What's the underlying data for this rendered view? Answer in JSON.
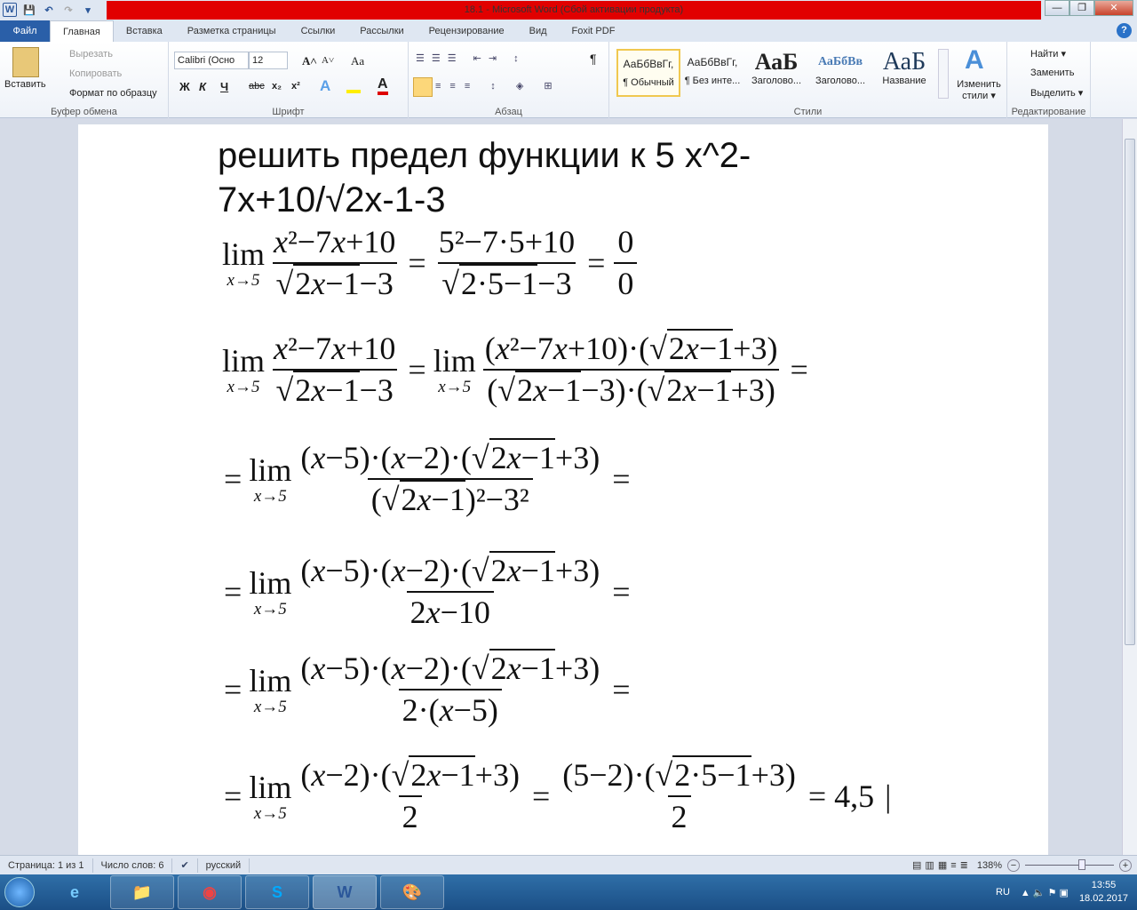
{
  "window": {
    "title": "18.1  -  Microsoft Word (Сбой активации продукта)",
    "minimize": "—",
    "maximize": "❐",
    "close": "✕"
  },
  "qat": {
    "word": "W",
    "save": "💾",
    "undo": "↶",
    "redo": "↷",
    "customize": "▾"
  },
  "tabs": [
    "Файл",
    "Главная",
    "Вставка",
    "Разметка страницы",
    "Ссылки",
    "Рассылки",
    "Рецензирование",
    "Вид",
    "Foxit PDF"
  ],
  "ribbon": {
    "clipboard": {
      "label": "Буфер обмена",
      "paste": "Вставить",
      "cut": "Вырезать",
      "copy": "Копировать",
      "format_painter": "Формат по образцу"
    },
    "font": {
      "label": "Шрифт",
      "font_name": "Calibri (Осно",
      "font_size": "12",
      "bold": "Ж",
      "italic": "К",
      "underline": "Ч",
      "strike": "abc",
      "sub": "x₂",
      "sup": "x²",
      "grow": "A˄",
      "shrink": "A˅",
      "case": "Aa"
    },
    "paragraph": {
      "label": "Абзац",
      "pilcrow": "¶"
    },
    "styles": {
      "label": "Стили",
      "items": [
        {
          "preview": "АаБбВвГг,",
          "name": "¶ Обычный"
        },
        {
          "preview": "АаБбВвГг,",
          "name": "¶ Без инте..."
        },
        {
          "preview": "АаБ",
          "name": "Заголово..."
        },
        {
          "preview": "АаБбВв",
          "name": "Заголово..."
        },
        {
          "preview": "АаБ",
          "name": "Название"
        }
      ],
      "change": "Изменить стили ▾"
    },
    "editing": {
      "label": "Редактирование",
      "find": "Найти ▾",
      "replace": "Заменить",
      "select": "Выделить ▾"
    }
  },
  "document": {
    "title_line1": "решить предел функции к 5 x^2-",
    "title_line2": "7x+10/√2x-1-3",
    "lim_word": "lim",
    "lim_sub": "x→5",
    "lines": [
      [
        {
          "t": "lim"
        },
        {
          "t": "frac",
          "n": "<i>x</i>²−7<i>x</i>+10",
          "d": "√{2<i>x</i>−1}−3"
        },
        {
          "t": "op",
          "v": "="
        },
        {
          "t": "frac",
          "n": "5²−7·5+10",
          "d": "√{2·5−1}−3"
        },
        {
          "t": "op",
          "v": "="
        },
        {
          "t": "frac",
          "n": "0",
          "d": "0"
        }
      ],
      [
        {
          "t": "lim"
        },
        {
          "t": "frac",
          "n": "<i>x</i>²−7<i>x</i>+10",
          "d": "√{2<i>x</i>−1}−3"
        },
        {
          "t": "op",
          "v": "="
        },
        {
          "t": "lim"
        },
        {
          "t": "frac",
          "n": "(<i>x</i>²−7<i>x</i>+10)·(√{2<i>x</i>−1}+3)",
          "d": "(√{2<i>x</i>−1}−3)·(√{2<i>x</i>−1}+3)"
        },
        {
          "t": "op",
          "v": "="
        }
      ],
      [
        {
          "t": "op",
          "v": "="
        },
        {
          "t": "lim"
        },
        {
          "t": "frac",
          "n": "(<i>x</i>−5)·(<i>x</i>−2)·(√{2<i>x</i>−1}+3)",
          "d": "(√{2<i>x</i>−1})²−3²"
        },
        {
          "t": "op",
          "v": "="
        }
      ],
      [
        {
          "t": "op",
          "v": "="
        },
        {
          "t": "lim"
        },
        {
          "t": "frac",
          "n": "(<i>x</i>−5)·(<i>x</i>−2)·(√{2<i>x</i>−1}+3)",
          "d": "2<i>x</i>−10"
        },
        {
          "t": "op",
          "v": "="
        }
      ],
      [
        {
          "t": "op",
          "v": "="
        },
        {
          "t": "lim"
        },
        {
          "t": "frac",
          "n": "(<i>x</i>−5)·(<i>x</i>−2)·(√{2<i>x</i>−1}+3)",
          "d": "2·(<i>x</i>−5)"
        },
        {
          "t": "op",
          "v": "="
        }
      ],
      [
        {
          "t": "op",
          "v": "="
        },
        {
          "t": "lim"
        },
        {
          "t": "frac",
          "n": "(<i>x</i>−2)·(√{2<i>x</i>−1}+3)",
          "d": "2"
        },
        {
          "t": "op",
          "v": "="
        },
        {
          "t": "frac",
          "n": "(5−2)·(√{2·5−1}+3)",
          "d": "2"
        },
        {
          "t": "op",
          "v": "= 4,5"
        },
        {
          "t": "op",
          "v": "|"
        }
      ]
    ]
  },
  "status": {
    "page": "Страница: 1 из 1",
    "words": "Число слов: 6",
    "lang": "русский",
    "zoom": "138%",
    "zoom_minus": "−",
    "zoom_plus": "+"
  },
  "taskbar": {
    "apps": [
      "e",
      "📁",
      "◉",
      "S",
      "W",
      "🎨"
    ],
    "lang": "RU",
    "time": "13:55",
    "date": "18.02.2017"
  }
}
